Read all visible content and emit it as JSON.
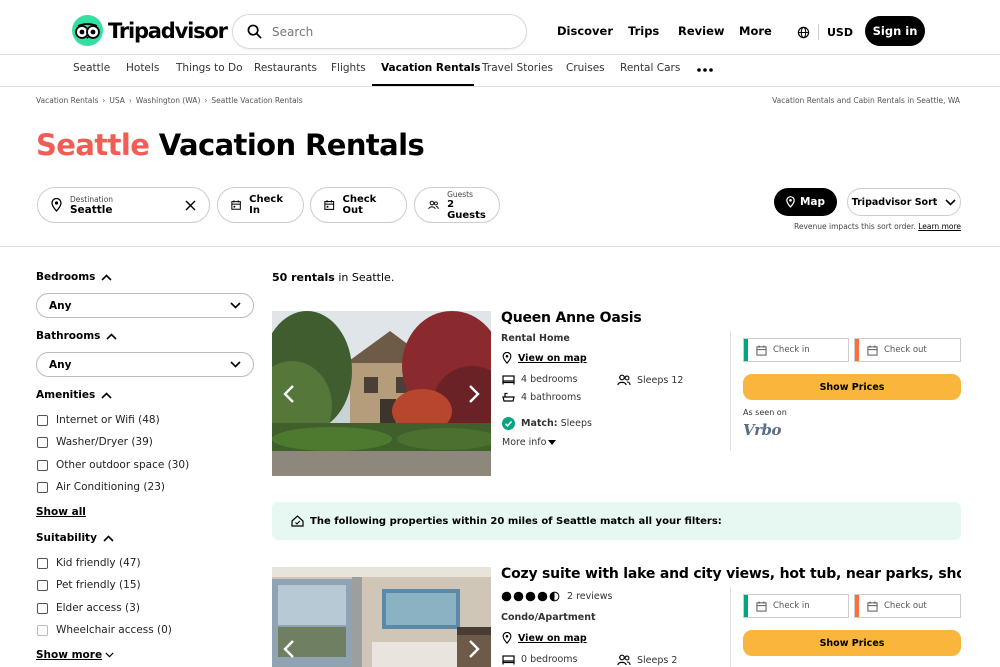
{
  "header": {
    "logo_text": "Tripadvisor",
    "search_placeholder": "Search",
    "nav": [
      "Discover",
      "Trips",
      "Review",
      "More"
    ],
    "currency": "USD",
    "signin": "Sign in"
  },
  "categories": [
    "Seattle",
    "Hotels",
    "Things to Do",
    "Restaurants",
    "Flights",
    "Vacation Rentals",
    "Travel Stories",
    "Cruises",
    "Rental Cars"
  ],
  "breadcrumbs": [
    "Vacation Rentals",
    "USA",
    "Washington (WA)",
    "Seattle Vacation Rentals"
  ],
  "breadcrumb_right": "Vacation Rentals and Cabin Rentals in Seattle, WA",
  "title": {
    "city": "Seattle",
    "rest": "Vacation Rentals"
  },
  "filterbar": {
    "destination_label": "Destination",
    "destination_value": "Seattle",
    "check_in": "Check In",
    "check_out": "Check Out",
    "guests_label": "Guests",
    "guests_value": "2 Guests",
    "map": "Map",
    "sort": "Tripadvisor Sort",
    "revenue_note": "Revenue impacts this sort order.",
    "learn_more": "Learn more"
  },
  "sidebar": {
    "bedrooms": {
      "label": "Bedrooms",
      "value": "Any"
    },
    "bathrooms": {
      "label": "Bathrooms",
      "value": "Any"
    },
    "amenities": {
      "label": "Amenities",
      "items": [
        "Internet or Wifi (48)",
        "Washer/Dryer (39)",
        "Other outdoor space (30)",
        "Air Conditioning (23)"
      ],
      "show_all": "Show all"
    },
    "suitability": {
      "label": "Suitability",
      "items": [
        "Kid friendly (47)",
        "Pet friendly (15)",
        "Elder access (3)",
        "Wheelchair access (0)"
      ],
      "show_more": "Show more"
    }
  },
  "results": {
    "count_bold": "50 rentals",
    "count_rest": " in Seattle.",
    "banner": "The following properties within 20 miles of Seattle match all your filters:",
    "listings": [
      {
        "title": "Queen Anne Oasis",
        "type": "Rental Home",
        "view_map": "View on map",
        "bedrooms": "4 bedrooms",
        "bathrooms": "4 bathrooms",
        "sleeps": "Sleeps 12",
        "match_label": "Match:",
        "match_value": "Sleeps",
        "more_info": "More info",
        "check_in": "Check in",
        "check_out": "Check out",
        "show_prices": "Show Prices",
        "seen_on": "As seen on",
        "provider": "Vrbo"
      },
      {
        "title": "Cozy suite with lake and city views, hot tub, near parks, shopping, ...",
        "rating": 4.5,
        "reviews": "2 reviews",
        "type": "Condo/Apartment",
        "view_map": "View on map",
        "bedrooms": "0 bedrooms",
        "sleeps": "Sleeps 2",
        "check_in": "Check in",
        "check_out": "Check out",
        "show_prices": "Show Prices"
      }
    ]
  },
  "colors": {
    "brand_green": "#34e0a1",
    "city_red": "#f25c54",
    "cta_yellow": "#f9b53c",
    "banner_bg": "#e6f8f1",
    "checkin_green": "#00a680",
    "checkout_orange": "#ff6d3b"
  }
}
